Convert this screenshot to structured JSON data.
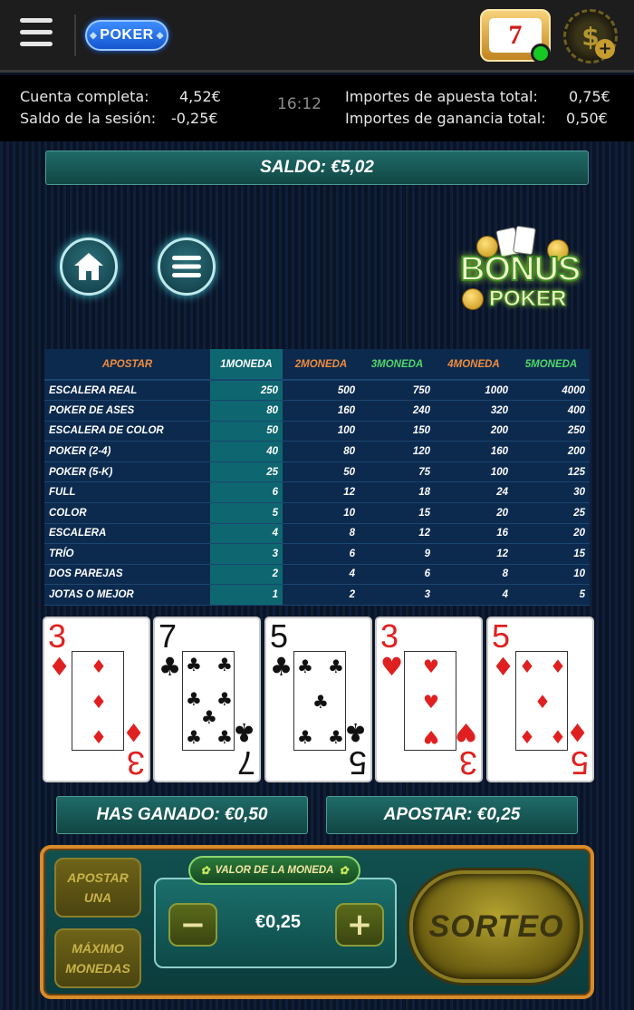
{
  "topbar": {
    "poker_label": "POKER",
    "slot_symbol": "7",
    "coin_symbol": "$",
    "coin_plus": "+"
  },
  "info": {
    "cuenta_label": "Cuenta completa:",
    "cuenta_value": "4,52€",
    "saldo_sesion_label": "Saldo de la sesión:",
    "saldo_sesion_value": "-0,25€",
    "clock": "16:12",
    "apuesta_total_label": "Importes de apuesta total:",
    "apuesta_total_value": "0,75€",
    "ganancia_total_label": "Importes de ganancia total:",
    "ganancia_total_value": "0,50€"
  },
  "saldo": "SALDO: €5,02",
  "logo": {
    "line1": "BONUS",
    "line2": "POKER"
  },
  "paytable": {
    "headers": [
      "APOSTAR",
      "1MONEDA",
      "2MONEDA",
      "3MONEDA",
      "4MONEDA",
      "5MONEDA"
    ],
    "rows": [
      [
        "ESCALERA REAL",
        "250",
        "500",
        "750",
        "1000",
        "4000"
      ],
      [
        "POKER DE ASES",
        "80",
        "160",
        "240",
        "320",
        "400"
      ],
      [
        "ESCALERA DE COLOR",
        "50",
        "100",
        "150",
        "200",
        "250"
      ],
      [
        "POKER (2-4)",
        "40",
        "80",
        "120",
        "160",
        "200"
      ],
      [
        "POKER (5-K)",
        "25",
        "50",
        "75",
        "100",
        "125"
      ],
      [
        "FULL",
        "6",
        "12",
        "18",
        "24",
        "30"
      ],
      [
        "COLOR",
        "5",
        "10",
        "15",
        "20",
        "25"
      ],
      [
        "ESCALERA",
        "4",
        "8",
        "12",
        "16",
        "20"
      ],
      [
        "TRÍO",
        "3",
        "6",
        "9",
        "12",
        "15"
      ],
      [
        "DOS PAREJAS",
        "2",
        "4",
        "6",
        "8",
        "10"
      ],
      [
        "JOTAS O MEJOR",
        "1",
        "2",
        "3",
        "4",
        "5"
      ]
    ]
  },
  "cards": [
    {
      "rank": "3",
      "suit": "♦",
      "color": "red"
    },
    {
      "rank": "7",
      "suit": "♣",
      "color": "black"
    },
    {
      "rank": "5",
      "suit": "♣",
      "color": "black"
    },
    {
      "rank": "3",
      "suit": "♥",
      "color": "red"
    },
    {
      "rank": "5",
      "suit": "♦",
      "color": "red"
    }
  ],
  "results": {
    "ganado": "HAS GANADO: €0,50",
    "apostar": "APOSTAR: €0,25"
  },
  "controls": {
    "apostar_una_line1": "APOSTAR",
    "apostar_una_line2": "UNA",
    "maximo_line1": "MÁXIMO",
    "maximo_line2": "MONEDAS",
    "valor_label": "VALOR DE LA MONEDA",
    "coin_value": "€0,25",
    "minus": "−",
    "plus": "+",
    "sorteo": "SORTEO"
  }
}
